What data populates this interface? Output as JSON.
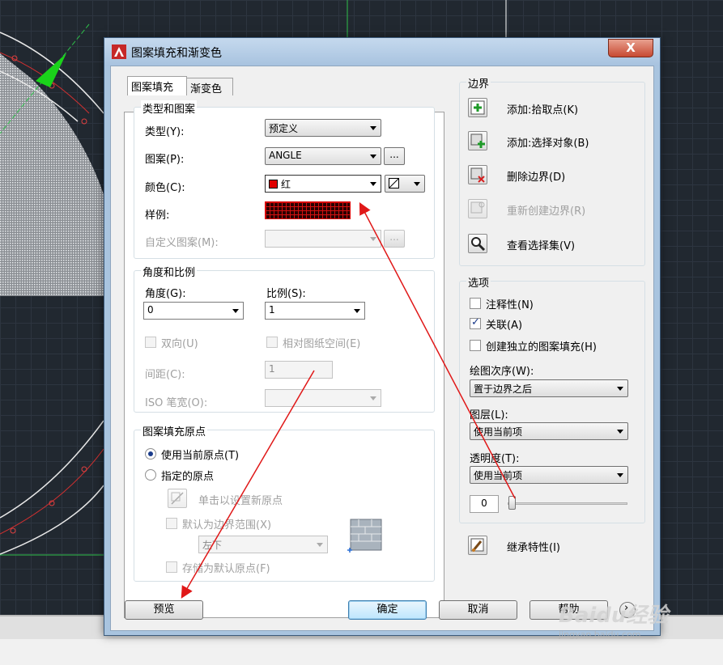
{
  "dialog": {
    "title": "图案填充和渐变色",
    "close_label": "X",
    "tabs": [
      "图案填充",
      "渐变色"
    ],
    "type_pattern": {
      "group_title": "类型和图案",
      "type_label": "类型(Y):",
      "type_value": "预定义",
      "pattern_label": "图案(P):",
      "pattern_value": "ANGLE",
      "pattern_browse": "...",
      "color_label": "颜色(C):",
      "color_value": "红",
      "color_swatch": "#e00000",
      "bgcolor_value": "",
      "sample_label": "样例:",
      "custom_label": "自定义图案(M):",
      "custom_value": "",
      "custom_browse": "..."
    },
    "angle_scale": {
      "group_title": "角度和比例",
      "angle_label": "角度(G):",
      "angle_value": "0",
      "scale_label": "比例(S):",
      "scale_value": "1",
      "double_label": "双向(U)",
      "relative_label": "相对图纸空间(E)",
      "spacing_label": "间距(C):",
      "spacing_value": "1",
      "iso_label": "ISO 笔宽(O):",
      "iso_value": ""
    },
    "origin": {
      "group_title": "图案填充原点",
      "use_current": "使用当前原点(T)",
      "specified": "指定的原点",
      "click_set": "单击以设置新原点",
      "default_boundary": "默认为边界范围(X)",
      "position_value": "左下",
      "store_default": "存储为默认原点(F)"
    },
    "boundaries": {
      "group_title": "边界",
      "add_pick": "添加:拾取点(K)",
      "add_select": "添加:选择对象(B)",
      "remove": "删除边界(D)",
      "recreate": "重新创建边界(R)",
      "view_selection": "查看选择集(V)"
    },
    "options": {
      "group_title": "选项",
      "annotative": "注释性(N)",
      "associative": "关联(A)",
      "separate": "创建独立的图案填充(H)",
      "draw_order_label": "绘图次序(W):",
      "draw_order_value": "置于边界之后",
      "layer_label": "图层(L):",
      "layer_value": "使用当前项",
      "transparency_label": "透明度(T):",
      "transparency_value": "使用当前项",
      "transparency_number": "0"
    },
    "inherit": "继承特性(I)",
    "buttons": {
      "preview": "预览",
      "ok": "确定",
      "cancel": "取消",
      "help": "帮助"
    }
  },
  "watermark": {
    "text": "Baidu经验",
    "sub": "jingyan.baidu.com"
  },
  "colors": {
    "accent_red": "#e00000",
    "cad_bg": "#212830",
    "title_bar": "#b7cfe8"
  }
}
